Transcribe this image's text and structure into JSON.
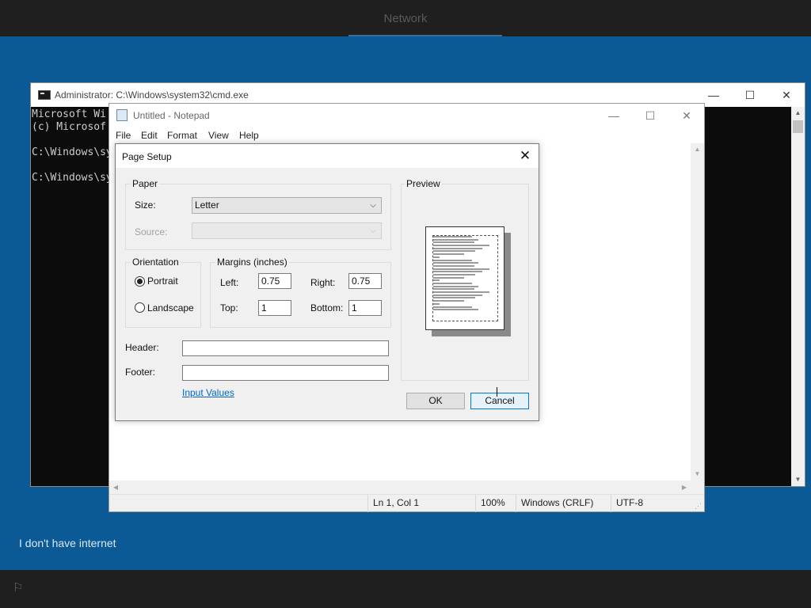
{
  "oobe": {
    "header_title": "Network",
    "skip_link": "I don't have internet",
    "ease_icon": "accessibility-icon"
  },
  "cmd": {
    "title": "Administrator: C:\\Windows\\system32\\cmd.exe",
    "lines": [
      "Microsoft Wi",
      "(c) Microsof",
      "",
      "C:\\Windows\\sy",
      "",
      "C:\\Windows\\sy"
    ]
  },
  "notepad": {
    "title": "Untitled - Notepad",
    "menu": [
      "File",
      "Edit",
      "Format",
      "View",
      "Help"
    ],
    "status": {
      "position": "Ln 1, Col 1",
      "zoom": "100%",
      "line_ending": "Windows (CRLF)",
      "encoding": "UTF-8"
    }
  },
  "page_setup": {
    "title": "Page Setup",
    "paper_group": "Paper",
    "size_label": "Size:",
    "size_value": "Letter",
    "source_label": "Source:",
    "source_value": "",
    "orientation_group": "Orientation",
    "portrait_label": "Portrait",
    "landscape_label": "Landscape",
    "orientation_selected": "Portrait",
    "margins_group": "Margins (inches)",
    "left_label": "Left:",
    "left_value": "0.75",
    "right_label": "Right:",
    "right_value": "0.75",
    "top_label": "Top:",
    "top_value": "1",
    "bottom_label": "Bottom:",
    "bottom_value": "1",
    "header_label": "Header:",
    "header_value": "",
    "footer_label": "Footer:",
    "footer_value": "",
    "input_values_link": "Input Values",
    "preview_group": "Preview",
    "ok_label": "OK",
    "cancel_label": "Cancel"
  }
}
